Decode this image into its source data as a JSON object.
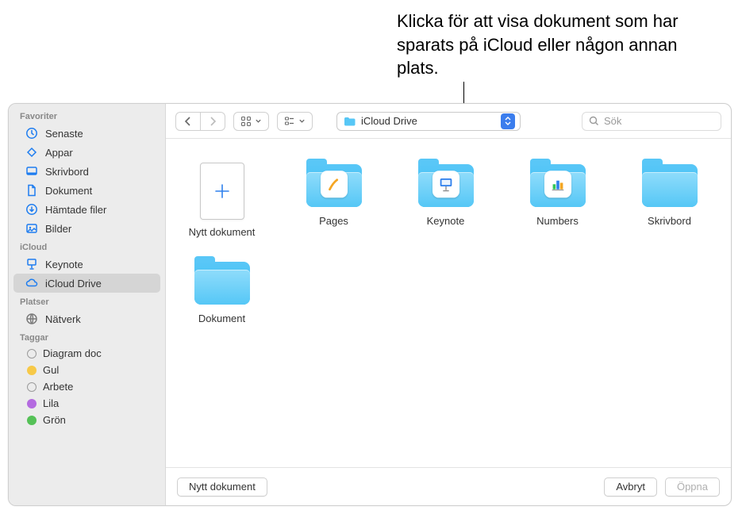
{
  "callout": "Klicka för att visa dokument som har sparats på iCloud eller någon annan plats.",
  "sidebar": {
    "sections": [
      {
        "title": "Favoriter",
        "items": [
          {
            "label": "Senaste",
            "icon": "clock-icon"
          },
          {
            "label": "Appar",
            "icon": "apps-icon"
          },
          {
            "label": "Skrivbord",
            "icon": "desktop-icon"
          },
          {
            "label": "Dokument",
            "icon": "document-icon"
          },
          {
            "label": "Hämtade filer",
            "icon": "download-icon"
          },
          {
            "label": "Bilder",
            "icon": "pictures-icon"
          }
        ]
      },
      {
        "title": "iCloud",
        "items": [
          {
            "label": "Keynote",
            "icon": "keynote-icon"
          },
          {
            "label": "iCloud Drive",
            "icon": "cloud-icon",
            "selected": true
          }
        ]
      },
      {
        "title": "Platser",
        "items": [
          {
            "label": "Nätverk",
            "icon": "globe-icon"
          }
        ]
      },
      {
        "title": "Taggar",
        "items": [
          {
            "label": "Diagram doc",
            "tagColor": "none"
          },
          {
            "label": "Gul",
            "tagColor": "#f7c948"
          },
          {
            "label": "Arbete",
            "tagColor": "none"
          },
          {
            "label": "Lila",
            "tagColor": "#b46be0"
          },
          {
            "label": "Grön",
            "tagColor": "#55c157"
          }
        ]
      }
    ]
  },
  "toolbar": {
    "location": "iCloud Drive",
    "search_placeholder": "Sök"
  },
  "grid": {
    "items": [
      {
        "label": "Nytt dokument",
        "kind": "new"
      },
      {
        "label": "Pages",
        "kind": "app-folder",
        "app": "pages"
      },
      {
        "label": "Keynote",
        "kind": "app-folder",
        "app": "keynote"
      },
      {
        "label": "Numbers",
        "kind": "app-folder",
        "app": "numbers"
      },
      {
        "label": "Skrivbord",
        "kind": "folder"
      },
      {
        "label": "Dokument",
        "kind": "folder"
      }
    ]
  },
  "footer": {
    "new_doc": "Nytt dokument",
    "cancel": "Avbryt",
    "open": "Öppna"
  }
}
